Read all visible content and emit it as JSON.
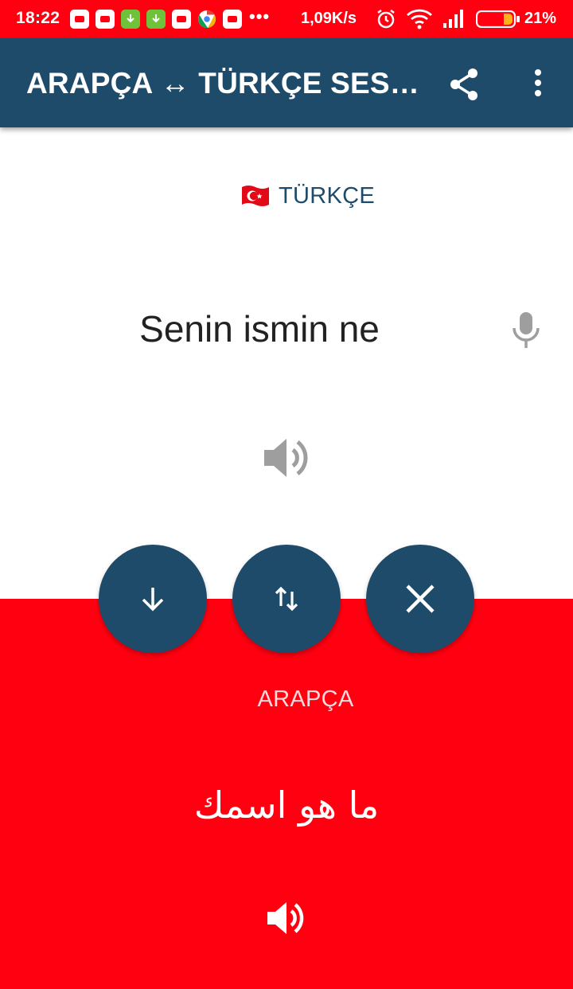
{
  "status_bar": {
    "time": "18:22",
    "overflow": "•••",
    "net_speed": "1,09K/s",
    "battery": "21%"
  },
  "app_bar": {
    "title": "ARAPÇA ↔ TÜRKÇE SES…",
    "share_icon": "share-icon",
    "menu_icon": "more-vert-icon"
  },
  "source": {
    "language": "TÜRKÇE",
    "flag_icon": "turkey-flag-icon",
    "text": "Senin ismin ne"
  },
  "target": {
    "language": "ARAPÇA",
    "text": "ما هو اسمك"
  },
  "actions": {
    "down_icon": "arrow-down-icon",
    "swap_icon": "swap-vertical-icon",
    "clear_icon": "close-icon"
  },
  "colors": {
    "primary": "#1f4b6b",
    "accent_red": "#ff0010",
    "icon_gray": "#9e9e9e"
  }
}
